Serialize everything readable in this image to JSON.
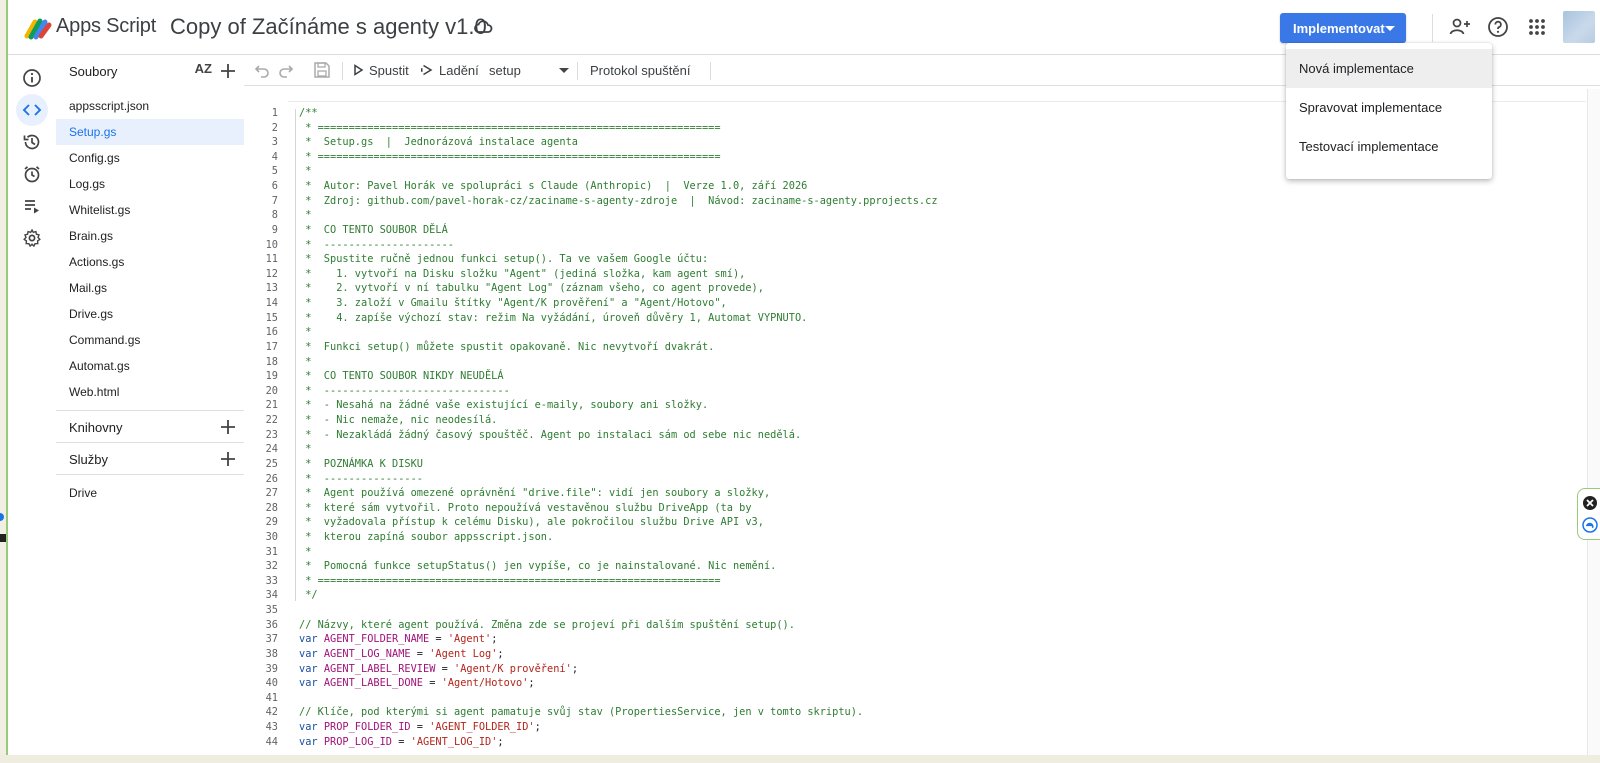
{
  "app": {
    "name": "Apps Script",
    "project_title": "Copy of Začínáme s agenty v1.0"
  },
  "header": {
    "deploy_label": "Implementovat"
  },
  "deploy_menu": {
    "items": [
      "Nová implementace",
      "Spravovat implementace",
      "Testovací implementace"
    ]
  },
  "files": {
    "title": "Soubory",
    "sort_label": "AZ",
    "items": [
      "appsscript.json",
      "Setup.gs",
      "Config.gs",
      "Log.gs",
      "Whitelist.gs",
      "Brain.gs",
      "Actions.gs",
      "Mail.gs",
      "Drive.gs",
      "Command.gs",
      "Automat.gs",
      "Web.html"
    ],
    "active": "Setup.gs"
  },
  "libraries": {
    "title": "Knihovny"
  },
  "services": {
    "title": "Služby",
    "items": [
      "Drive"
    ]
  },
  "toolbar": {
    "run_label": "Spustit",
    "debug_label": "Ladění",
    "function_select": "setup",
    "log_label": "Protokol spuštění"
  },
  "icons": {
    "rail": [
      "info-icon",
      "code-icon",
      "history-icon",
      "alarm-icon",
      "executions-icon",
      "settings-icon"
    ],
    "header": [
      "share-person-icon",
      "help-icon",
      "apps-grid-icon"
    ],
    "toolbar": [
      "undo-icon",
      "redo-icon",
      "save-icon",
      "play-icon",
      "debug-icon"
    ]
  },
  "code": {
    "line_numbers": [
      "1",
      "2",
      "3",
      "4",
      "5",
      "6",
      "7",
      "8",
      "9",
      "10",
      "11",
      "12",
      "13",
      "14",
      "15",
      "16",
      "17",
      "18",
      "19",
      "20",
      "21",
      "22",
      "23",
      "24",
      "25",
      "26",
      "27",
      "28",
      "29",
      "30",
      "31",
      "32",
      "33",
      "34",
      "35",
      "36",
      "37",
      "38",
      "39",
      "40",
      "41",
      "42",
      "43",
      "44"
    ],
    "lines": [
      [
        [
          "cm",
          "/**"
        ]
      ],
      [
        [
          "cm",
          " * ================================================================="
        ]
      ],
      [
        [
          "cm",
          " *  Setup.gs  |  Jednorázová instalace agenta"
        ]
      ],
      [
        [
          "cm",
          " * ================================================================="
        ]
      ],
      [
        [
          "cm",
          " *"
        ]
      ],
      [
        [
          "cm",
          " *  Autor: Pavel Horák ve spolupráci s Claude (Anthropic)  |  Verze 1.0, září 2026"
        ]
      ],
      [
        [
          "cm",
          " *  Zdroj: github.com/pavel-horak-cz/zaciname-s-agenty-zdroje  |  Návod: zaciname-s-agenty.pprojects.cz"
        ]
      ],
      [
        [
          "cm",
          " *"
        ]
      ],
      [
        [
          "cm",
          " *  CO TENTO SOUBOR DĚLÁ"
        ]
      ],
      [
        [
          "cm",
          " *  ---------------------"
        ]
      ],
      [
        [
          "cm",
          " *  Spustite ručně jednou funkci setup(). Ta ve vašem Google účtu:"
        ]
      ],
      [
        [
          "cm",
          " *    1. vytvoří na Disku složku \"Agent\" (jediná složka, kam agent smí),"
        ]
      ],
      [
        [
          "cm",
          " *    2. vytvoří v ní tabulku \"Agent Log\" (záznam všeho, co agent provede),"
        ]
      ],
      [
        [
          "cm",
          " *    3. založí v Gmailu štítky \"Agent/K prověření\" a \"Agent/Hotovo\","
        ]
      ],
      [
        [
          "cm",
          " *    4. zapíše výchozí stav: režim Na vyžádání, úroveň důvěry 1, Automat VYPNUTO."
        ]
      ],
      [
        [
          "cm",
          " *"
        ]
      ],
      [
        [
          "cm",
          " *  Funkci setup() můžete spustit opakovaně. Nic nevytvoří dvakrát."
        ]
      ],
      [
        [
          "cm",
          " *"
        ]
      ],
      [
        [
          "cm",
          " *  CO TENTO SOUBOR NIKDY NEUDĚLÁ"
        ]
      ],
      [
        [
          "cm",
          " *  ------------------------------"
        ]
      ],
      [
        [
          "cm",
          " *  - Nesahá na žádné vaše existující e-maily, soubory ani složky."
        ]
      ],
      [
        [
          "cm",
          " *  - Nic nemaže, nic neodesílá."
        ]
      ],
      [
        [
          "cm",
          " *  - Nezakládá žádný časový spouštěč. Agent po instalaci sám od sebe nic nedělá."
        ]
      ],
      [
        [
          "cm",
          " *"
        ]
      ],
      [
        [
          "cm",
          " *  POZNÁMKA K DISKU"
        ]
      ],
      [
        [
          "cm",
          " *  ----------------"
        ]
      ],
      [
        [
          "cm",
          " *  Agent používá omezené oprávnění \"drive.file\": vidí jen soubory a složky,"
        ]
      ],
      [
        [
          "cm",
          " *  které sám vytvořil. Proto nepoužívá vestavěnou službu DriveApp (ta by"
        ]
      ],
      [
        [
          "cm",
          " *  vyžadovala přístup k celému Disku), ale pokročilou službu Drive API v3,"
        ]
      ],
      [
        [
          "cm",
          " *  kterou zapíná soubor appsscript.json."
        ]
      ],
      [
        [
          "cm",
          " *"
        ]
      ],
      [
        [
          "cm",
          " *  Pomocná funkce setupStatus() jen vypíše, co je nainstalované. Nic nemění."
        ]
      ],
      [
        [
          "cm",
          " * ================================================================="
        ]
      ],
      [
        [
          "cm",
          " */"
        ]
      ],
      [
        [
          "pl",
          ""
        ]
      ],
      [
        [
          "cm",
          "// Názvy, které agent používá. Změna zde se projeví při dalším spuštění setup()."
        ]
      ],
      [
        [
          "kw",
          "var "
        ],
        [
          "vn",
          "AGENT_FOLDER_NAME"
        ],
        [
          "pl",
          " = "
        ],
        [
          "st",
          "'Agent'"
        ],
        [
          "pl",
          ";"
        ]
      ],
      [
        [
          "kw",
          "var "
        ],
        [
          "vn",
          "AGENT_LOG_NAME"
        ],
        [
          "pl",
          " = "
        ],
        [
          "st",
          "'Agent Log'"
        ],
        [
          "pl",
          ";"
        ]
      ],
      [
        [
          "kw",
          "var "
        ],
        [
          "vn",
          "AGENT_LABEL_REVIEW"
        ],
        [
          "pl",
          " = "
        ],
        [
          "st",
          "'Agent/K prověření'"
        ],
        [
          "pl",
          ";"
        ]
      ],
      [
        [
          "kw",
          "var "
        ],
        [
          "vn",
          "AGENT_LABEL_DONE"
        ],
        [
          "pl",
          " = "
        ],
        [
          "st",
          "'Agent/Hotovo'"
        ],
        [
          "pl",
          ";"
        ]
      ],
      [
        [
          "pl",
          ""
        ]
      ],
      [
        [
          "cm",
          "// Klíče, pod kterými si agent pamatuje svůj stav (PropertiesService, jen v tomto skriptu)."
        ]
      ],
      [
        [
          "kw",
          "var "
        ],
        [
          "vn",
          "PROP_FOLDER_ID"
        ],
        [
          "pl",
          " = "
        ],
        [
          "st",
          "'AGENT_FOLDER_ID'"
        ],
        [
          "pl",
          ";"
        ]
      ],
      [
        [
          "kw",
          "var "
        ],
        [
          "vn",
          "PROP_LOG_ID"
        ],
        [
          "pl",
          " = "
        ],
        [
          "st",
          "'AGENT_LOG_ID'"
        ],
        [
          "pl",
          ";"
        ]
      ]
    ]
  }
}
